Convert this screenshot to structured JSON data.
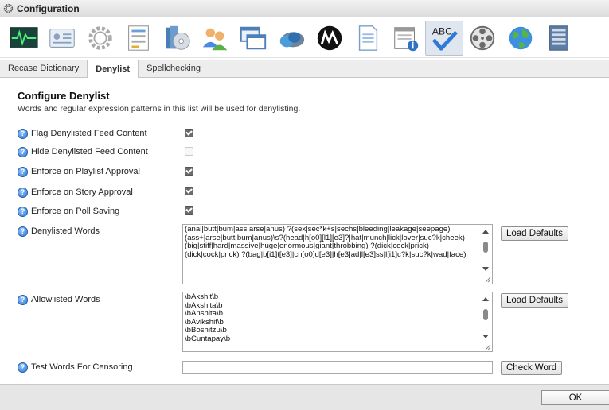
{
  "window": {
    "title": "Configuration"
  },
  "toolbar": {
    "icons": [
      "monitor-icon",
      "id-card-icon",
      "gear-icon",
      "form-icon",
      "disc-box-icon",
      "users-icon",
      "windows-icon",
      "cloud-icon",
      "m-logo-icon",
      "document-icon",
      "calendar-info-icon",
      "spellcheck-icon",
      "film-reel-icon",
      "globe-icon",
      "server-icon"
    ],
    "spellcheck_text": "ABC"
  },
  "tabs": [
    {
      "label": "Recase Dictionary",
      "selected": false
    },
    {
      "label": "Denylist",
      "selected": true
    },
    {
      "label": "Spellchecking",
      "selected": false
    }
  ],
  "section": {
    "title": "Configure Denylist",
    "description": "Words and regular expression patterns in this list will be used for denylisting."
  },
  "help_glyph": "?",
  "options": [
    {
      "label": "Flag Denylisted Feed Content",
      "checked": true,
      "enabled": true
    },
    {
      "label": "Hide Denylisted Feed Content",
      "checked": false,
      "enabled": false
    },
    {
      "label": "Enforce on Playlist Approval",
      "checked": true,
      "enabled": true
    },
    {
      "label": "Enforce on Story Approval",
      "checked": true,
      "enabled": true
    },
    {
      "label": "Enforce on Poll Saving",
      "checked": true,
      "enabled": true
    }
  ],
  "denylisted": {
    "label": "Denylisted Words",
    "value": "(anal|butt|bum|ass|arse|anus) ?(sex|sec*k+s|sechs|bleeding|leakage|seepage)\n(ass+|arse|butt|bum|anus)\\s?(head|h[o0][l1][e3]?|hat|munch|lick|lover|suc?k|cheek)\n(big|stiff|hard|massive|huge|enormous|giant|throbbing) ?(dick|cock|prick)\n(dick|cock|prick) ?(bag|b[i1]t[e3]|ch[o0]d[e3]|h[e3]ad|l[e3]ss|l[i1]c?k|suc?k|wad|face)",
    "button": "Load Defaults"
  },
  "allowlisted": {
    "label": "Allowlisted Words",
    "value": "\\bAkshit\\b\n\\bAkshita\\b\n\\bAnshita\\b\n\\bAvikshit\\b\n\\bBoshitzu\\b\n\\bCuntapay\\b",
    "button": "Load Defaults"
  },
  "test": {
    "label": "Test Words For Censoring",
    "value": "",
    "button": "Check Word"
  },
  "footer": {
    "ok": "OK"
  }
}
